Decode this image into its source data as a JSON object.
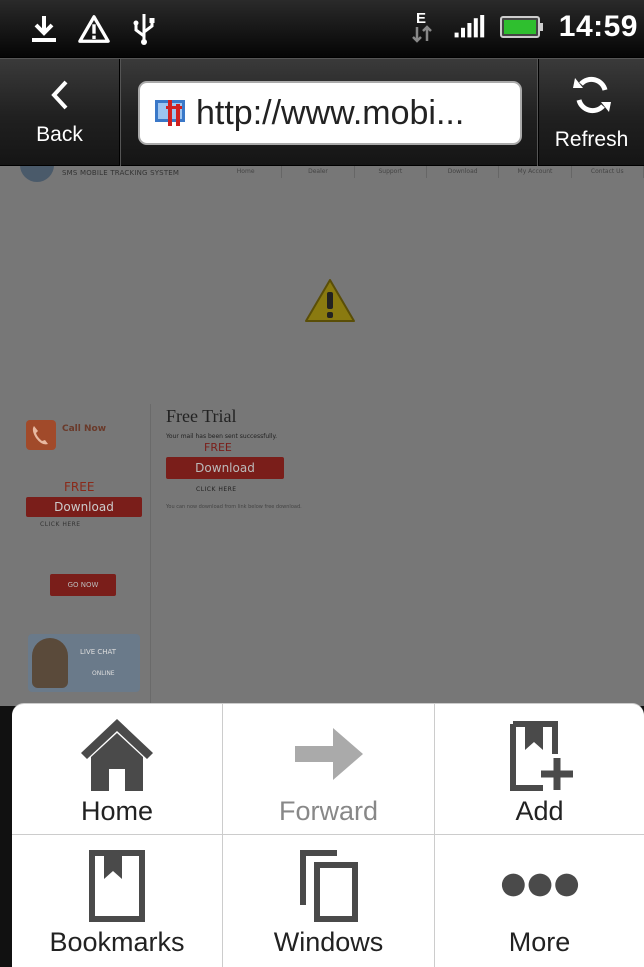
{
  "status_bar": {
    "time": "14:59",
    "left_icons": [
      "download-icon",
      "warning-icon",
      "usb-icon"
    ],
    "right_icons": [
      "data-edge-icon",
      "signal-icon",
      "battery-icon"
    ],
    "network_type": "E"
  },
  "toolbar": {
    "back_label": "Back",
    "refresh_label": "Refresh",
    "url": "http://www.mobi..."
  },
  "webpage": {
    "tagline": "SMS MOBILE TRACKING SYSTEM",
    "nav_items": [
      "Home",
      "Dealer",
      "Support",
      "Download",
      "My Account",
      "Contact Us"
    ],
    "call_now": "Call Now",
    "side_free": "FREE",
    "side_download": "Download",
    "side_click_here": "CLICK HERE",
    "side_button": "GO NOW",
    "live_chat": "LIVE CHAT",
    "live_chat_status": "ONLINE",
    "free_trial_title": "Free Trial",
    "free_trial_message": "Your mail has been sent successfully.",
    "main_free": "FREE",
    "main_download": "Download",
    "main_click_here": "CLICK HERE",
    "main_note": "You can now download from link below free download."
  },
  "menu": {
    "items": [
      {
        "label": "Home",
        "icon": "home-icon",
        "enabled": true
      },
      {
        "label": "Forward",
        "icon": "forward-arrow-icon",
        "enabled": false
      },
      {
        "label": "Add",
        "icon": "add-bookmark-icon",
        "enabled": true
      },
      {
        "label": "Bookmarks",
        "icon": "bookmark-icon",
        "enabled": true
      },
      {
        "label": "Windows",
        "icon": "windows-icon",
        "enabled": true
      },
      {
        "label": "More",
        "icon": "more-icon",
        "enabled": true
      }
    ]
  },
  "colors": {
    "status_bar_bg": "#000000",
    "toolbar_bg": "#202020",
    "menu_bg": "#ffffff",
    "menu_icon": "#4a4a4a",
    "disabled_icon": "#aaaaaa",
    "battery_green": "#2fbf2f"
  }
}
